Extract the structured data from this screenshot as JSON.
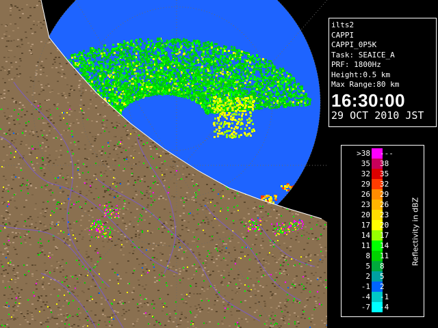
{
  "info": {
    "radar": "ilts2",
    "product": "CAPPI",
    "product_name": "CAPPI_0P5K",
    "task": "Task: SEAICE_A",
    "prf": "PRF: 1800Hz",
    "height": "Height:0.5 km",
    "max_range": "Max Range:80 km",
    "time": "16:30:00",
    "date": "29 OCT 2010 JST"
  },
  "legend": {
    "unit_label": "Reflectivity in dBZ",
    "rows": [
      {
        "low": ">38",
        "high": "---",
        "color": "#ff00ff"
      },
      {
        "low": "35",
        "high": "38",
        "color": "#c8005a"
      },
      {
        "low": "32",
        "high": "35",
        "color": "#dc0000"
      },
      {
        "low": "29",
        "high": "32",
        "color": "#ff3c00"
      },
      {
        "low": "26",
        "high": "29",
        "color": "#ff8c00"
      },
      {
        "low": "23",
        "high": "26",
        "color": "#ffb400"
      },
      {
        "low": "20",
        "high": "23",
        "color": "#ffdc00"
      },
      {
        "low": "17",
        "high": "20",
        "color": "#ffff00"
      },
      {
        "low": "14",
        "high": "17",
        "color": "#96ff00"
      },
      {
        "low": "11",
        "high": "14",
        "color": "#00ff00"
      },
      {
        "low": "8",
        "high": "11",
        "color": "#00d200"
      },
      {
        "low": "5",
        "high": "8",
        "color": "#00aa3c"
      },
      {
        "low": "2",
        "high": "5",
        "color": "#00a0a0"
      },
      {
        "low": "-1",
        "high": "2",
        "color": "#0064ff"
      },
      {
        "low": "-4",
        "high": "-1",
        "color": "#00c8c8"
      },
      {
        "low": "-7",
        "high": "-4",
        "color": "#00ffff"
      }
    ]
  },
  "map": {
    "land_color": "#8a7050",
    "sea_color": "#000000",
    "coverage_color": "#1e64ff",
    "border_color": "#7a5ad2"
  }
}
